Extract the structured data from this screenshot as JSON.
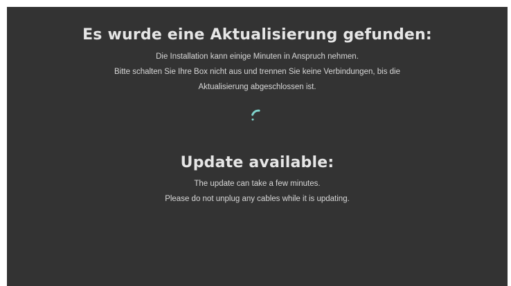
{
  "german": {
    "title": "Es wurde eine Aktualisierung gefunden:",
    "line1": "Die Installation kann einige Minuten in Anspruch nehmen.",
    "line2": "Bitte schalten Sie Ihre Box nicht aus und trennen Sie keine Verbindungen, bis die",
    "line3": "Aktualisierung abgeschlossen ist."
  },
  "english": {
    "title": "Update available:",
    "line1": "The update can take a few minutes.",
    "line2": "Please do not unplug any cables while it is updating."
  },
  "spinner": {
    "icon": "loading-spinner-icon",
    "color": "#7fd3cc"
  },
  "colors": {
    "background": "#333333",
    "text": "#e0e0e0"
  }
}
